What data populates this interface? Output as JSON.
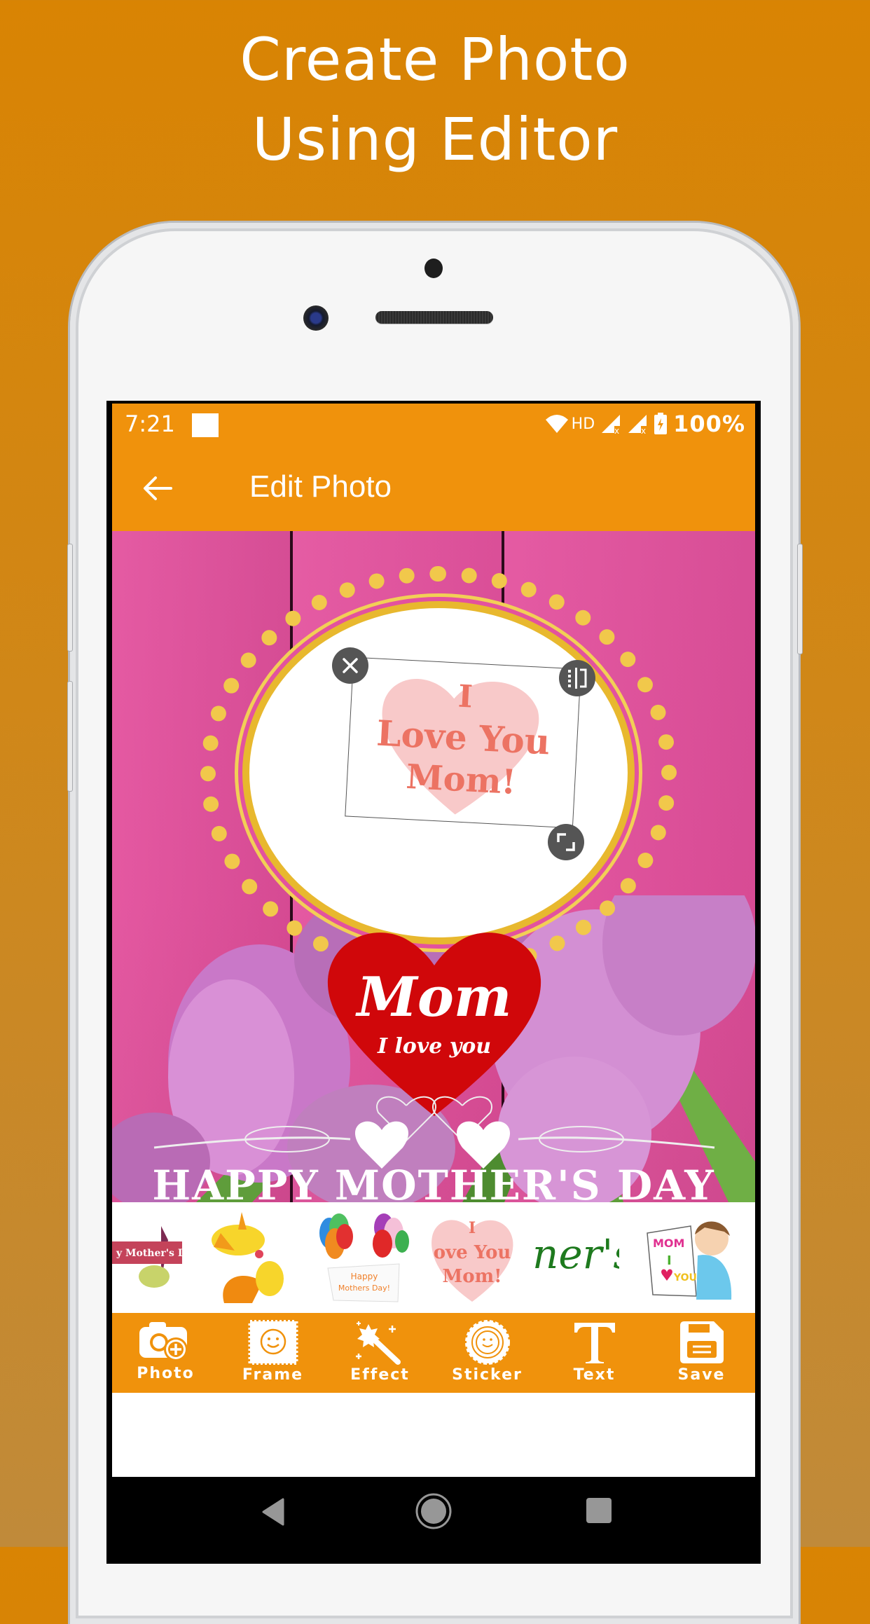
{
  "promo": {
    "headline_line1": "Create Photo",
    "headline_line2": "Using Editor",
    "background_color": "#D98403"
  },
  "status_bar": {
    "time": "7:21",
    "network_label": "HD",
    "battery_percent": "100%",
    "icons": [
      "notification-icon",
      "wifi-icon",
      "signal-icon",
      "signal-icon",
      "battery-charging-icon"
    ]
  },
  "app_bar": {
    "title": "Edit Photo",
    "back_icon": "arrow-left-icon",
    "color": "#F0920C"
  },
  "canvas": {
    "selected_sticker": {
      "line1": "I",
      "line2": "Love You",
      "line3": "Mom!",
      "handles": [
        "close-icon",
        "flip-icon",
        "resize-icon"
      ]
    },
    "heart_text_main": "Mom",
    "heart_text_sub": "I love you",
    "banner_text": "HAPPY MOTHER'S DAY"
  },
  "sticker_strip": {
    "items": [
      {
        "name": "happy-mothers-day-ribbon",
        "text": "y Mother's D"
      },
      {
        "name": "birds-sticker",
        "text": ""
      },
      {
        "name": "balloons-sticker",
        "text": "Happy Mothers Day!"
      },
      {
        "name": "i-love-you-mom-sticker",
        "text": "I Love You Mom!"
      },
      {
        "name": "script-text-sticker",
        "text": "ner's"
      },
      {
        "name": "boy-mom-card-sticker",
        "text": "MOM I YOU"
      }
    ]
  },
  "toolbar": {
    "items": [
      {
        "label": "Photo",
        "icon": "camera-add-icon"
      },
      {
        "label": "Frame",
        "icon": "frame-icon"
      },
      {
        "label": "Effect",
        "icon": "magic-wand-icon"
      },
      {
        "label": "Sticker",
        "icon": "sticker-icon"
      },
      {
        "label": "Text",
        "icon": "text-icon"
      },
      {
        "label": "Save",
        "icon": "save-icon"
      }
    ]
  },
  "nav_bar": {
    "buttons": [
      "back-icon",
      "home-icon",
      "recents-icon"
    ]
  }
}
